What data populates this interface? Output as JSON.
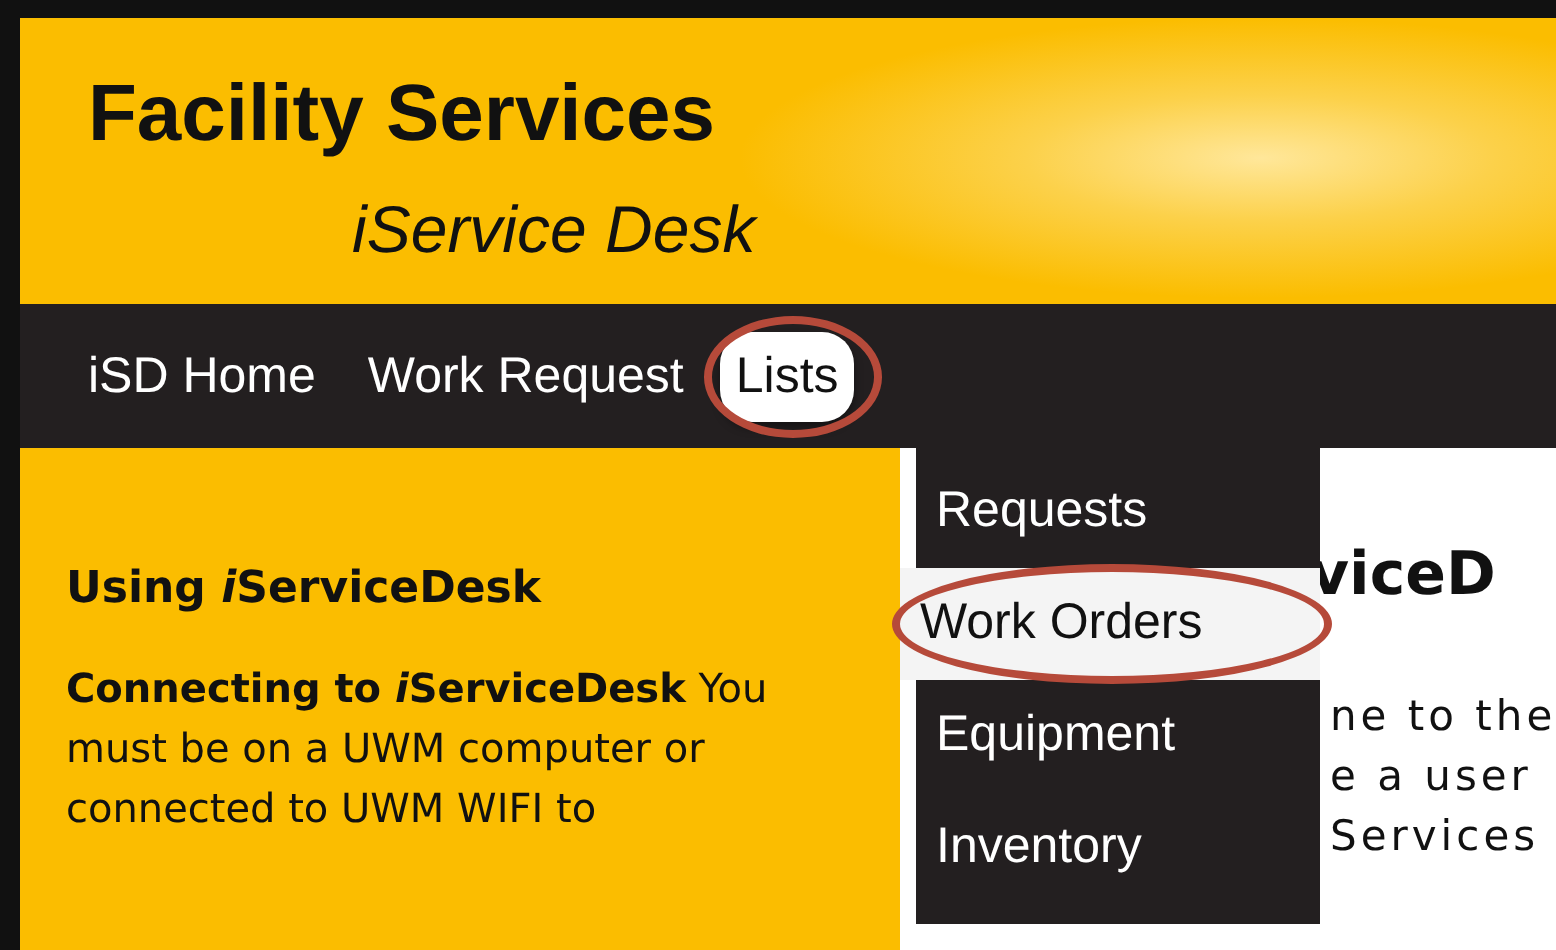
{
  "header": {
    "title": "Facility Services",
    "subtitle": "iService Desk"
  },
  "nav": {
    "items": [
      {
        "label": "iSD Home",
        "selected": false,
        "circled": false
      },
      {
        "label": "Work Request",
        "selected": false,
        "circled": false
      },
      {
        "label": "Lists",
        "selected": true,
        "circled": true
      }
    ]
  },
  "dropdown": {
    "items": [
      {
        "label": "Requests",
        "selected": false,
        "circled": false
      },
      {
        "label": "Work Orders",
        "selected": true,
        "circled": true
      },
      {
        "label": "Equipment",
        "selected": false,
        "circled": false
      },
      {
        "label": "Inventory",
        "selected": false,
        "circled": false
      }
    ]
  },
  "sidebar": {
    "heading": [
      {
        "text": "Using ",
        "bold": true,
        "italic": false
      },
      {
        "text": "i",
        "bold": true,
        "italic": true
      },
      {
        "text": "ServiceDesk",
        "bold": true,
        "italic": false
      }
    ],
    "text": [
      {
        "text": "Connecting to ",
        "bold": true,
        "italic": false
      },
      {
        "text": "i",
        "bold": true,
        "italic": true
      },
      {
        "text": "ServiceDesk",
        "bold": true,
        "italic": false
      },
      {
        "text": " You must be on a UWM computer or connected to UWM WIFI to",
        "bold": false,
        "italic": false
      }
    ]
  },
  "content": {
    "heading": "viceD",
    "lines": [
      "ne to the",
      "e a user",
      "Services"
    ]
  }
}
